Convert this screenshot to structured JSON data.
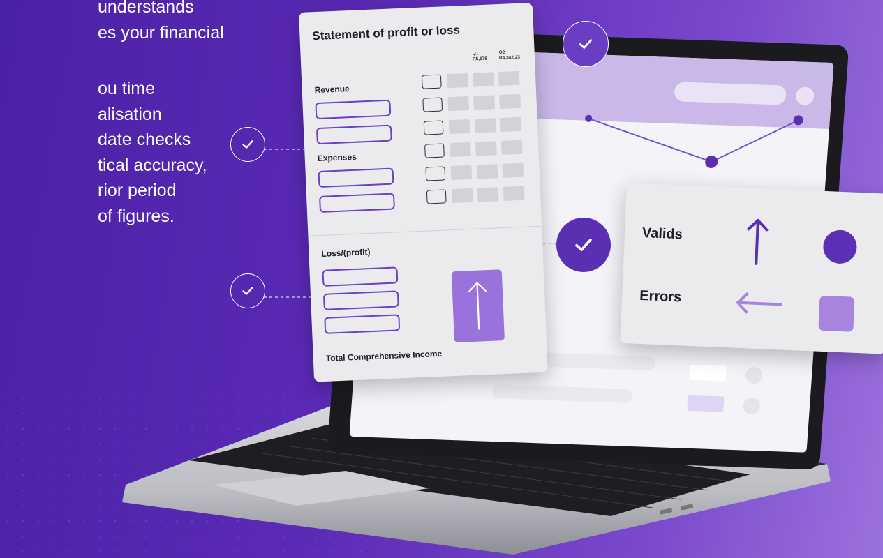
{
  "copy": {
    "lines": [
      "understands",
      "es your financial",
      "ou time",
      "alisation",
      "date checks",
      "tical accuracy,",
      "rior period",
      "of figures."
    ]
  },
  "statement": {
    "title": "Statement of profit or loss",
    "q1_label": "Q1",
    "q1_value": "R5,678",
    "q2_label": "Q2",
    "q2_value": "R4,342,23",
    "revenue_label": "Revenue",
    "expenses_label": "Expenses",
    "loss_label": "Loss/(profit)",
    "total_label": "Total Comprehensive Income"
  },
  "legend": {
    "valids_label": "Valids",
    "errors_label": "Errors"
  },
  "colors": {
    "accent": "#5b2fb2",
    "accent_light": "#9a72dc",
    "background_start": "#4a22a6",
    "background_end": "#9a72dc"
  },
  "icons": [
    "check-icon",
    "arrow-up-icon",
    "arrow-left-icon"
  ]
}
